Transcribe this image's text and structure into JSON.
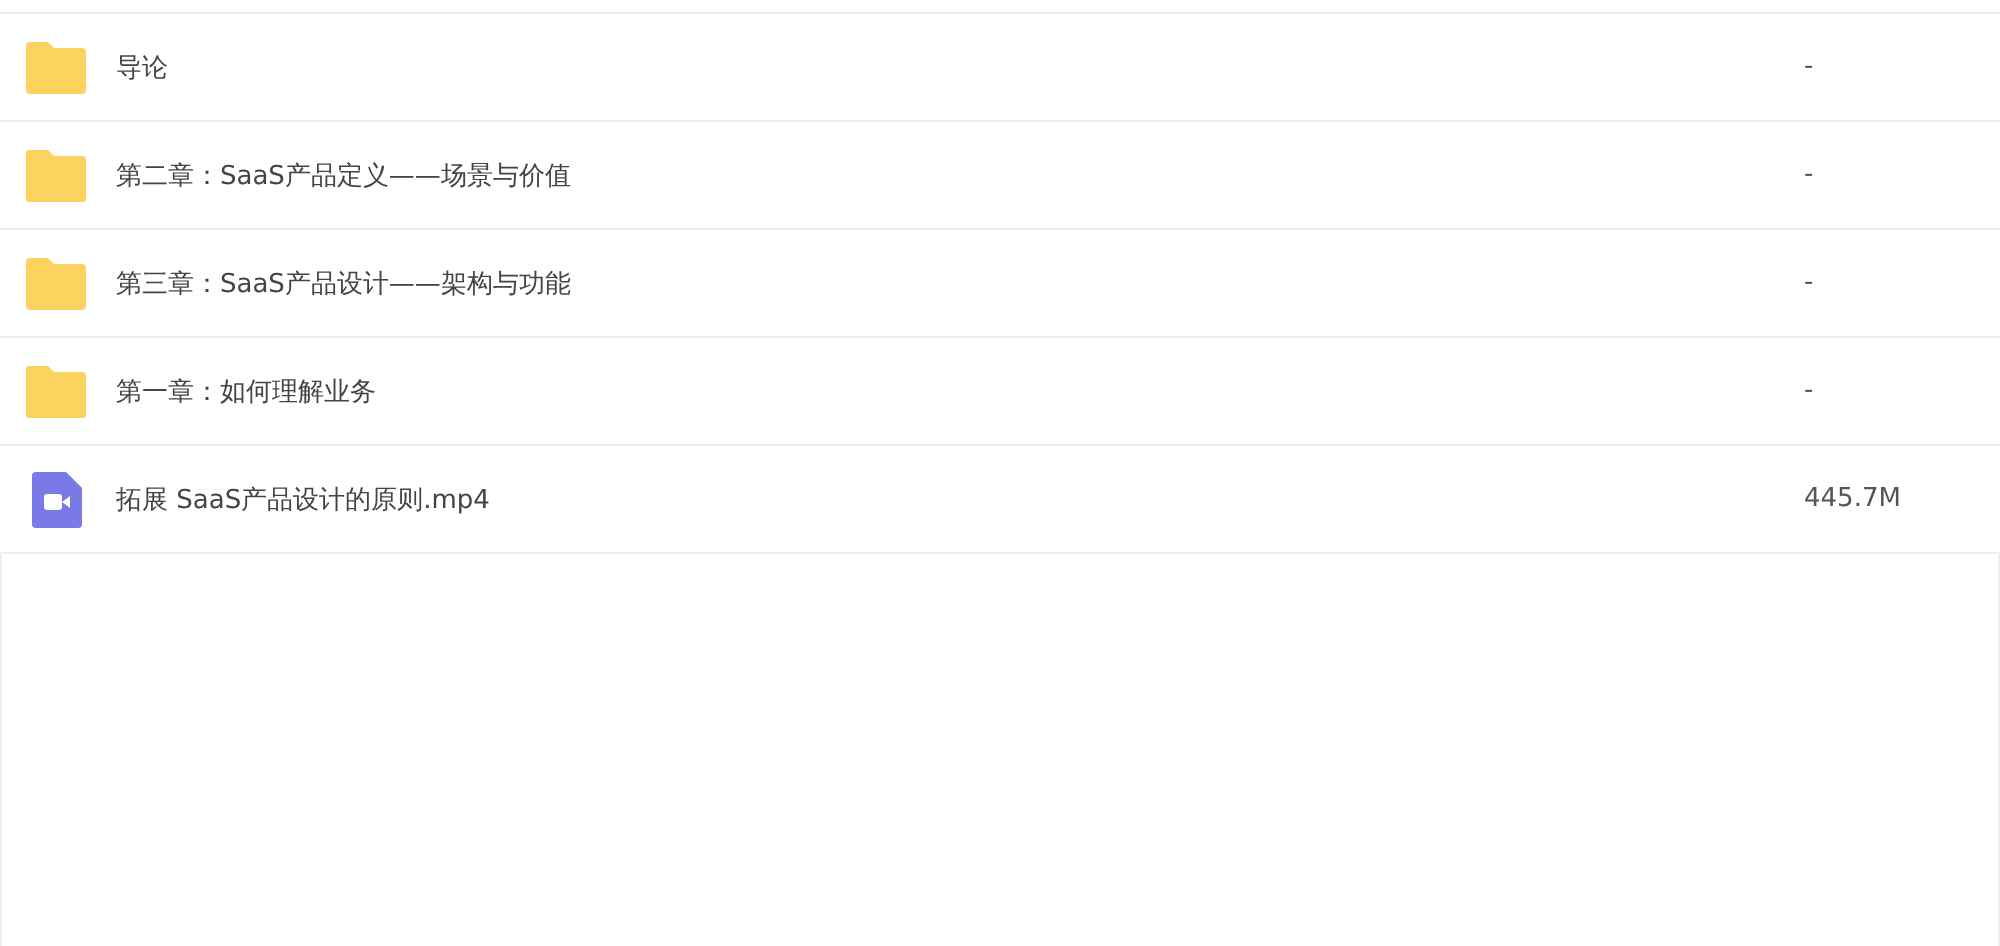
{
  "files": [
    {
      "kind": "folder",
      "name": "导论",
      "size": "-"
    },
    {
      "kind": "folder",
      "name": "第二章：SaaS产品定义——场景与价值",
      "size": "-"
    },
    {
      "kind": "folder",
      "name": "第三章：SaaS产品设计——架构与功能",
      "size": "-"
    },
    {
      "kind": "folder",
      "name": "第一章：如何理解业务",
      "size": "-"
    },
    {
      "kind": "video",
      "name": "拓展 SaaS产品设计的原则.mp4",
      "size": "445.7M"
    }
  ]
}
